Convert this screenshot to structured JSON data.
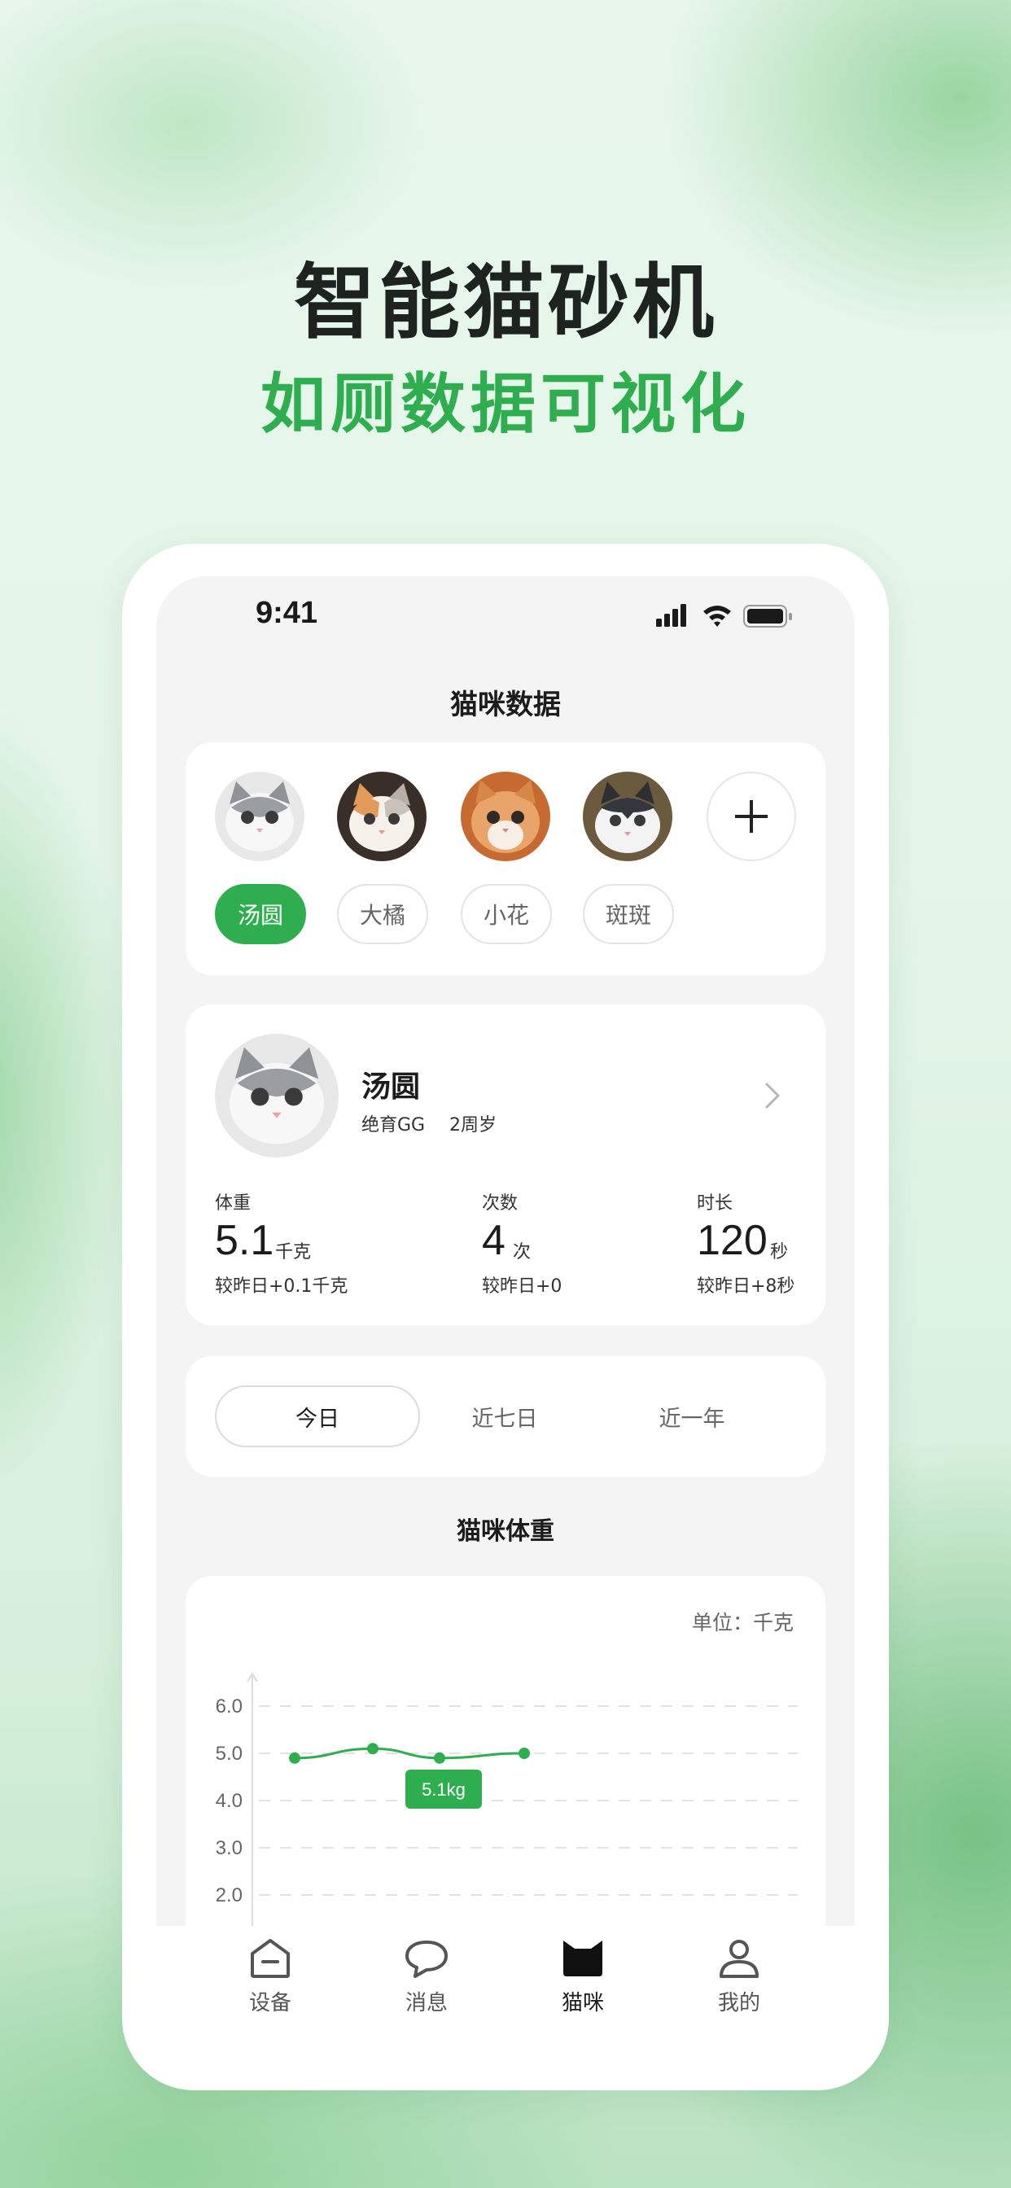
{
  "headline": {
    "title": "智能猫砂机",
    "subtitle": "如厕数据可视化"
  },
  "status_bar": {
    "time": "9:41"
  },
  "page": {
    "title": "猫咪数据"
  },
  "cats": [
    {
      "name": "汤圆",
      "active": true
    },
    {
      "name": "大橘",
      "active": false
    },
    {
      "name": "小花",
      "active": false
    },
    {
      "name": "斑斑",
      "active": false
    }
  ],
  "profile": {
    "name": "汤圆",
    "tag1": "绝育GG",
    "tag2": "2周岁",
    "stats": [
      {
        "label": "体重",
        "value": "5.1",
        "unit": "千克",
        "compare": "较昨日+0.1千克"
      },
      {
        "label": "次数",
        "value": "4",
        "unit": "次",
        "compare": "较昨日+0"
      },
      {
        "label": "时长",
        "value": "120",
        "unit": "秒",
        "compare": "较昨日+8秒"
      }
    ]
  },
  "range_tabs": {
    "today": "今日",
    "week": "近七日",
    "year": "近一年",
    "selected": "今日"
  },
  "weight_chart": {
    "section_title": "猫咪体重",
    "unit_label": "单位：千克",
    "tooltip": "5.1kg"
  },
  "chart_data": {
    "type": "line",
    "title": "猫咪体重",
    "xlabel": "",
    "ylabel": "",
    "ylim": [
      2.0,
      6.0
    ],
    "y_ticks": [
      "6.0",
      "5.0",
      "4.0",
      "3.0",
      "2.0"
    ],
    "series": [
      {
        "values": [
          4.9,
          5.1,
          4.9,
          5.0
        ]
      }
    ],
    "grid": true,
    "annotation": "5.1kg"
  },
  "nav": [
    {
      "label": "设备",
      "icon": "home-icon",
      "active": false
    },
    {
      "label": "消息",
      "icon": "message-icon",
      "active": false
    },
    {
      "label": "猫咪",
      "icon": "cat-icon",
      "active": true
    },
    {
      "label": "我的",
      "icon": "user-icon",
      "active": false
    }
  ],
  "colors": {
    "accent": "#2eae4f",
    "headline": "#1e2320",
    "subtitle": "#2eae4f"
  }
}
